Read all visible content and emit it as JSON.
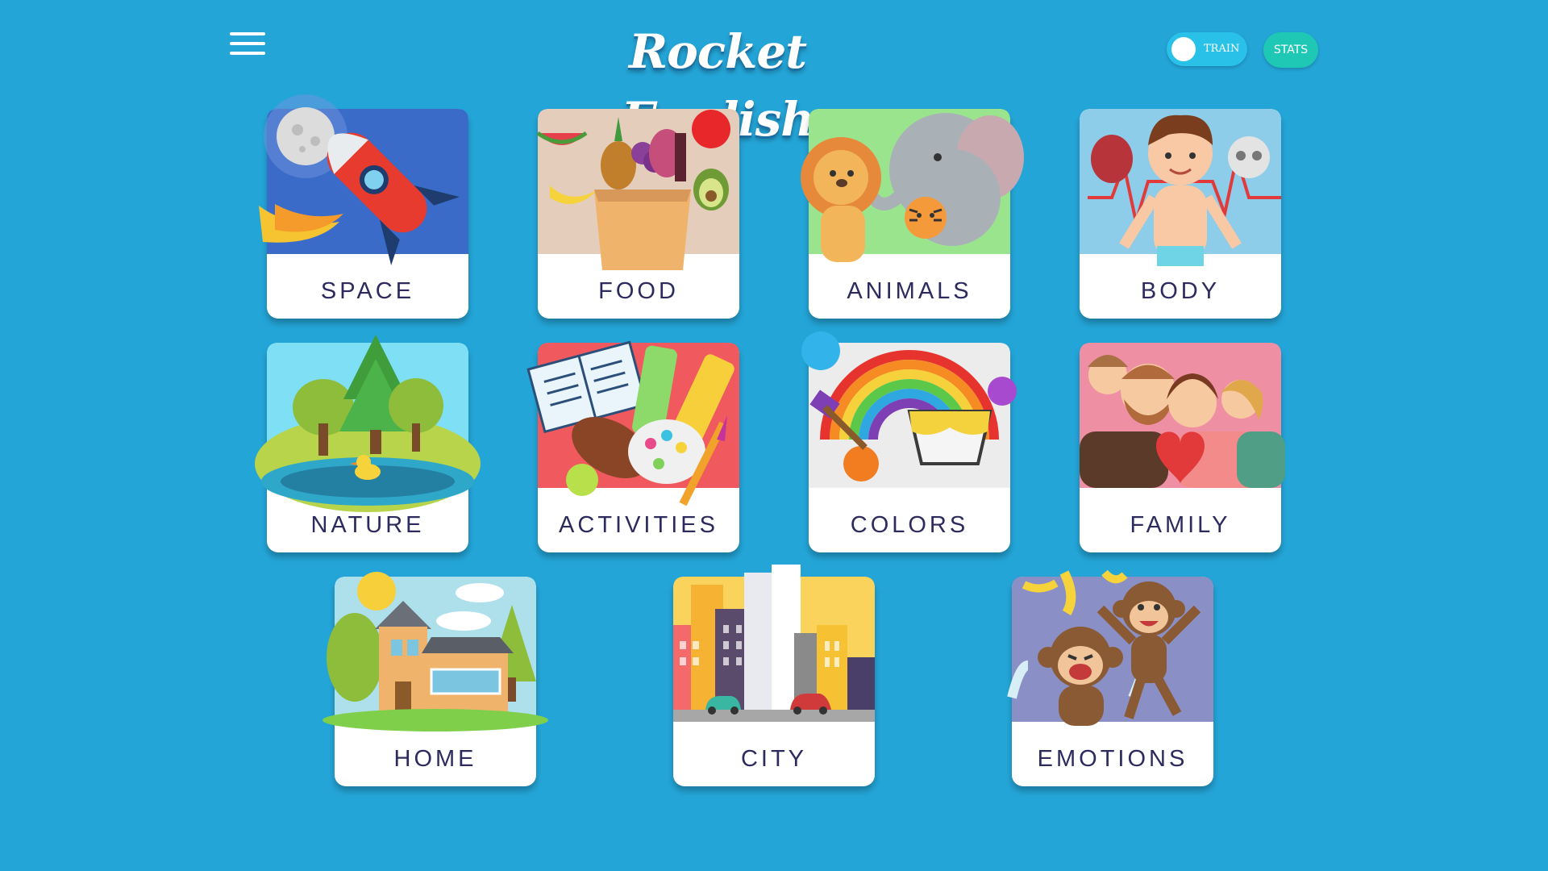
{
  "header": {
    "title": "Rocket English",
    "menu_icon": "hamburger-menu-icon",
    "train_label": "TRAIN",
    "stats_label": "STATS"
  },
  "colors": {
    "background": "#24a5d8",
    "card": "#ffffff",
    "label_text": "#2d2a5e",
    "train_toggle": "#2ac1e8",
    "stats_button": "#1fc8b4"
  },
  "categories": [
    {
      "label": "SPACE",
      "icon": "rocket-moon-icon"
    },
    {
      "label": "FOOD",
      "icon": "grocery-bag-icon"
    },
    {
      "label": "ANIMALS",
      "icon": "lion-elephant-tiger-icon"
    },
    {
      "label": "BODY",
      "icon": "human-body-icon"
    },
    {
      "label": "NATURE",
      "icon": "trees-pond-duck-icon"
    },
    {
      "label": "ACTIVITIES",
      "icon": "book-ball-paint-icon"
    },
    {
      "label": "COLORS",
      "icon": "rainbow-paint-icon"
    },
    {
      "label": "FAMILY",
      "icon": "family-heart-icon"
    },
    {
      "label": "HOME",
      "icon": "house-trees-icon"
    },
    {
      "label": "CITY",
      "icon": "city-buildings-icon"
    },
    {
      "label": "EMOTIONS",
      "icon": "monkeys-icon"
    }
  ]
}
